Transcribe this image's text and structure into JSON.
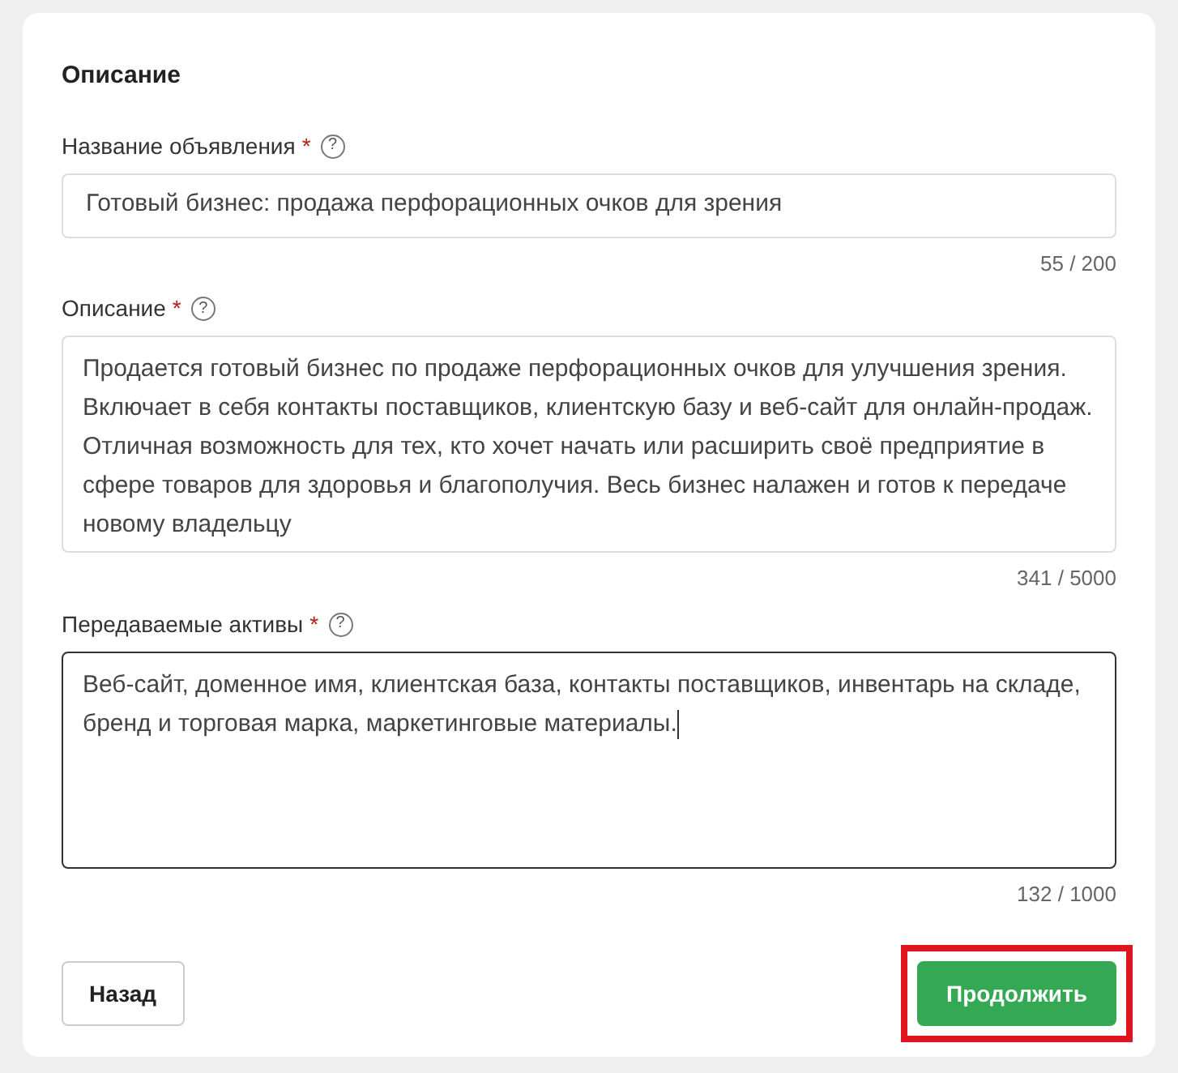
{
  "section_title": "Описание",
  "fields": [
    {
      "kind": "input",
      "label": "Название объявления",
      "required": true,
      "value": "Готовый бизнес: продажа перфорационных очков для зрения",
      "counter": "55 / 200",
      "focused": false
    },
    {
      "kind": "textarea",
      "label": "Описание",
      "required": true,
      "value": "Продается готовый бизнес по продаже перфорационных очков для улучшения зрения. Включает в себя контакты поставщиков, клиентскую базу и веб-сайт для онлайн-продаж. Отличная возможность для тех, кто хочет начать или расширить своё предприятие в сфере товаров для здоровья и благополучия. Весь бизнес налажен и готов к передаче новому владельцу",
      "counter": "341 / 5000",
      "focused": false
    },
    {
      "kind": "textarea",
      "label": "Передаваемые активы",
      "required": true,
      "value": "Веб-сайт, доменное имя, клиентская база, контакты поставщиков, инвентарь на складе, бренд и торговая марка, маркетинговые материалы.",
      "counter": "132 / 1000",
      "focused": true
    }
  ],
  "required_mark": "*",
  "help_mark": "?",
  "buttons": [
    {
      "kind": "secondary",
      "label": "Назад",
      "highlighted": false
    },
    {
      "kind": "primary",
      "label": "Продолжить",
      "highlighted": true
    }
  ]
}
